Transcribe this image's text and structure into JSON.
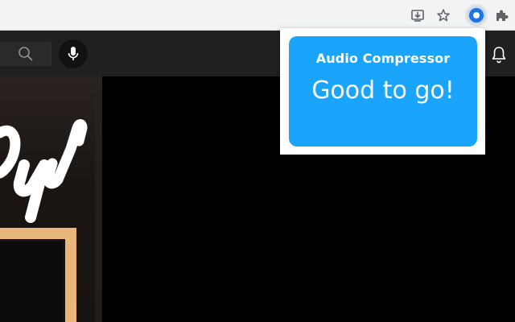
{
  "browser": {
    "toolbar_icons": [
      "download-to-device-icon",
      "bookmark-star-icon",
      "extension-active-icon",
      "extensions-puzzle-icon"
    ]
  },
  "youtube_header": {
    "icons": [
      "search-icon",
      "microphone-icon",
      "notifications-bell-icon"
    ]
  },
  "extension_popup": {
    "title": "Audio Compressor",
    "status": "Good to go!",
    "accent_color": "#1ba4fb"
  }
}
